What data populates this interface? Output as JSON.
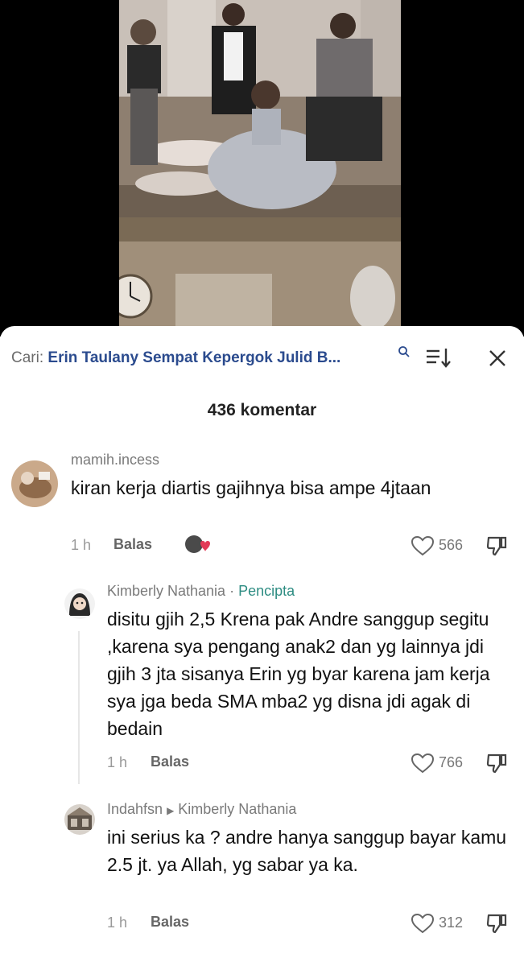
{
  "search": {
    "prefix": "Cari:",
    "query": "Erin Taulany Sempat Kepergok Julid B..."
  },
  "comments_header": {
    "count_label": "436 komentar"
  },
  "comments": [
    {
      "username": "mamih.incess",
      "text": "kiran kerja diartis gajihnya bisa ampe 4jtaan",
      "time": "1 h",
      "reply_label": "Balas",
      "likes": "566"
    },
    {
      "username": "Kimberly Nathania",
      "separator": "·",
      "badge": "Pencipta",
      "text": "disitu gjih 2,5 Krena pak Andre sanggup segitu ,karena sya pengang anak2 dan yg lainnya jdi gjih 3 jta sisanya Erin yg byar karena jam kerja sya jga beda SMA mba2 yg disna jdi agak di bedain",
      "time": "1 h",
      "reply_label": "Balas",
      "likes": "766"
    },
    {
      "username": "Indahfsn",
      "reply_to": "Kimberly Nathania",
      "text": "ini serius ka ? andre hanya sanggup bayar kamu 2.5 jt. ya Allah, yg sabar ya ka.",
      "time": "1 h",
      "reply_label": "Balas",
      "likes": "312"
    }
  ],
  "colors": {
    "accent_link": "#2b4b8e",
    "creator_badge": "#2d8c82",
    "muted_text": "#7a7a7a"
  }
}
